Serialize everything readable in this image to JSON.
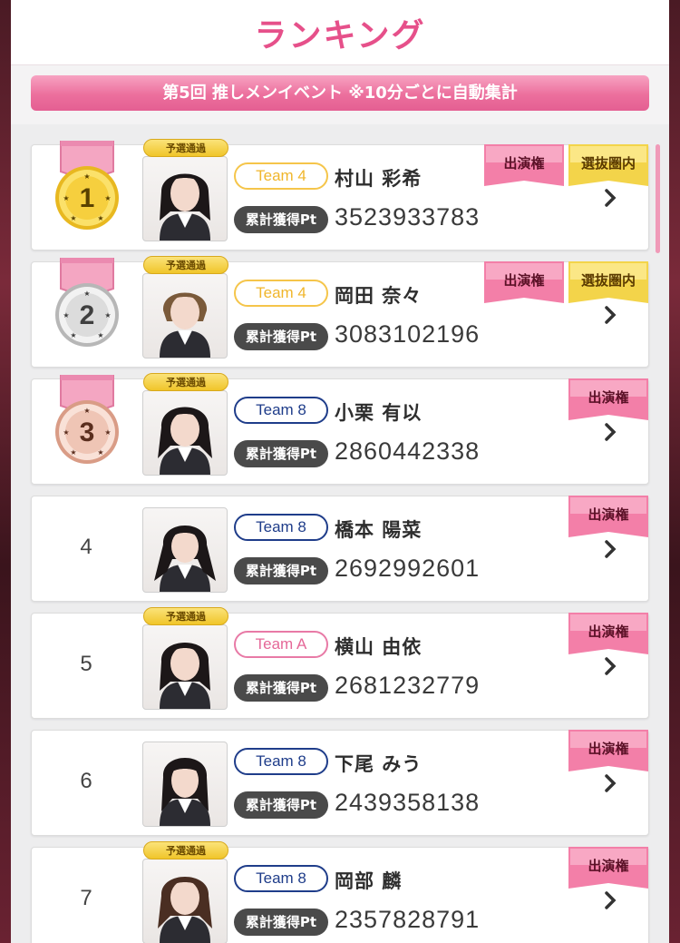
{
  "header": {
    "title": "ランキング",
    "event_banner": "第5回 推しメンイベント ※10分ごとに自動集計"
  },
  "labels": {
    "points_label": "累計獲得Pt",
    "qualifier_badge": "予選通過",
    "appearance_flag": "出演権",
    "selection_flag": "選抜圏内"
  },
  "colors": {
    "accent": "#e6508a",
    "team4": "#f5c54a",
    "team8": "#1f3d8a",
    "teamA": "#e87aa6",
    "gold_medal": "#f2c93a",
    "silver_medal": "#d9d9d9",
    "bronze_medal": "#ecc3b4"
  },
  "rankings": [
    {
      "rank": "1",
      "team": "Team 4",
      "name": "村山 彩希",
      "points": "3523933783",
      "qualified": true,
      "medal": "gold-medal-icon",
      "flags": [
        "出演権",
        "選抜圏内"
      ]
    },
    {
      "rank": "2",
      "team": "Team 4",
      "name": "岡田 奈々",
      "points": "3083102196",
      "qualified": true,
      "medal": "silver-medal-icon",
      "flags": [
        "出演権",
        "選抜圏内"
      ]
    },
    {
      "rank": "3",
      "team": "Team 8",
      "name": "小栗 有以",
      "points": "2860442338",
      "qualified": true,
      "medal": "bronze-medal-icon",
      "flags": [
        "出演権"
      ]
    },
    {
      "rank": "4",
      "team": "Team 8",
      "name": "橋本 陽菜",
      "points": "2692992601",
      "qualified": false,
      "medal": null,
      "flags": [
        "出演権"
      ]
    },
    {
      "rank": "5",
      "team": "Team A",
      "name": "横山 由依",
      "points": "2681232779",
      "qualified": true,
      "medal": null,
      "flags": [
        "出演権"
      ]
    },
    {
      "rank": "6",
      "team": "Team 8",
      "name": "下尾 みう",
      "points": "2439358138",
      "qualified": false,
      "medal": null,
      "flags": [
        "出演権"
      ]
    },
    {
      "rank": "7",
      "team": "Team 8",
      "name": "岡部 麟",
      "points": "2357828791",
      "qualified": true,
      "medal": null,
      "flags": [
        "出演権"
      ]
    }
  ]
}
